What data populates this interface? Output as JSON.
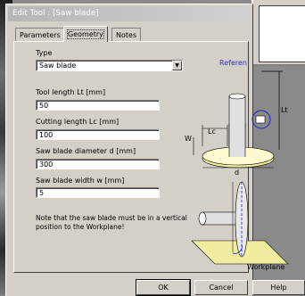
{
  "dialog": {
    "title": "Edit Tool : [Saw blade]",
    "close_glyph": "✕"
  },
  "tabs": [
    "Parameters",
    "Geometry",
    "Notes"
  ],
  "form": {
    "type_label": "Type",
    "type_value": "Saw blade",
    "tool_length_label": "Tool length Lt [mm]",
    "tool_length_value": "50",
    "cutting_length_label": "Cutting length Lc [mm]",
    "cutting_length_value": "100",
    "diameter_label": "Saw blade diameter d [mm]",
    "diameter_value": "300",
    "width_label": "Saw blade width w [mm]",
    "width_value": "5"
  },
  "note": "Note that the saw blade must be in a vertical position to the Workplane!",
  "diagram": {
    "reference_label": "Referen",
    "lt": "Lt",
    "lc": "Lc",
    "w": "W",
    "d": "d",
    "workplane": "Workplane"
  },
  "buttons": {
    "ok": "OK",
    "cancel": "Cancel",
    "help": "Help"
  },
  "colors": {
    "face": "#d4d0c8",
    "title": "#c8c8c8",
    "accent_blue": "#2020c0",
    "base_yellow": "#f0eca0"
  }
}
